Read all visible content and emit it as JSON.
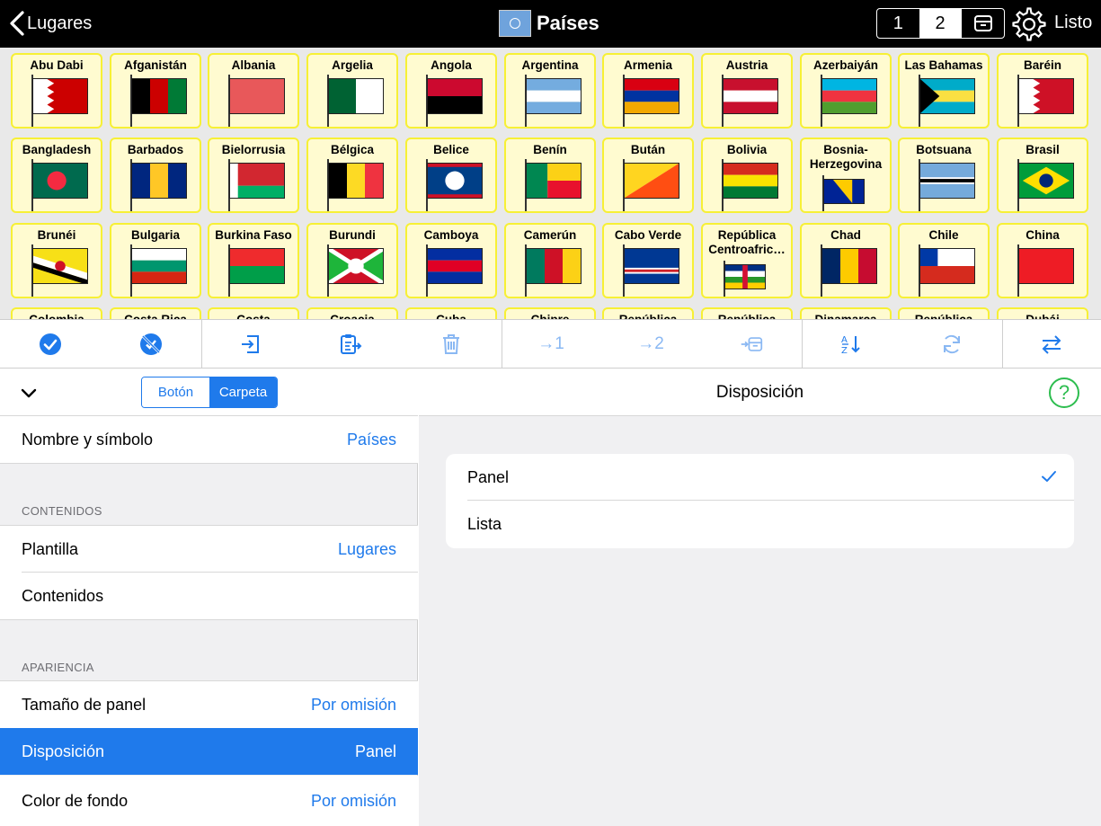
{
  "topbar": {
    "back_label": "Lugares",
    "title": "Países",
    "page_1": "1",
    "page_2": "2",
    "done_label": "Listo"
  },
  "grid": {
    "rows": [
      [
        {
          "name": "Abu Dabi",
          "colors": [
            "#c00",
            "#fff"
          ],
          "pattern": "bahrain"
        },
        {
          "name": "Afganistán",
          "colors": [
            "#000",
            "#c00",
            "#007a36"
          ],
          "pattern": "v3"
        },
        {
          "name": "Albania",
          "colors": [
            "#e8585a"
          ],
          "pattern": "solid"
        },
        {
          "name": "Argelia",
          "colors": [
            "#006233",
            "#fff"
          ],
          "pattern": "v2"
        },
        {
          "name": "Angola",
          "colors": [
            "#cc092f",
            "#000"
          ],
          "pattern": "h2"
        },
        {
          "name": "Argentina",
          "colors": [
            "#74acdf",
            "#fff",
            "#74acdf"
          ],
          "pattern": "h3"
        },
        {
          "name": "Armenia",
          "colors": [
            "#d90012",
            "#0033a0",
            "#f2a800"
          ],
          "pattern": "h3"
        },
        {
          "name": "Austria",
          "colors": [
            "#c8102e",
            "#fff",
            "#c8102e"
          ],
          "pattern": "h3"
        },
        {
          "name": "Azerbaiyán",
          "colors": [
            "#00b5e2",
            "#ef3340",
            "#509e2f"
          ],
          "pattern": "h3"
        },
        {
          "name": "Las Bahamas",
          "colors": [
            "#00abc9",
            "#fae042",
            "#00abc9"
          ],
          "pattern": "h3tri"
        },
        {
          "name": "Baréin",
          "colors": [
            "#ce1126",
            "#fff"
          ],
          "pattern": "bahrain"
        }
      ],
      [
        {
          "name": "Bangladesh",
          "colors": [
            "#006a4e"
          ],
          "pattern": "disc"
        },
        {
          "name": "Barbados",
          "colors": [
            "#00267f",
            "#ffc726",
            "#00267f"
          ],
          "pattern": "v3"
        },
        {
          "name": "Bielorrusia",
          "colors": [
            "#d22730",
            "#00af66"
          ],
          "pattern": "h2by"
        },
        {
          "name": "Bélgica",
          "colors": [
            "#000",
            "#fdda24",
            "#ef3340"
          ],
          "pattern": "v3"
        },
        {
          "name": "Belice",
          "colors": [
            "#003f87",
            "#ce1126"
          ],
          "pattern": "belize"
        },
        {
          "name": "Benín",
          "colors": [
            "#008751",
            "#fcd116",
            "#e8112d"
          ],
          "pattern": "benin"
        },
        {
          "name": "Bután",
          "colors": [
            "#ffd520",
            "#ff4e12"
          ],
          "pattern": "diag"
        },
        {
          "name": "Bolivia",
          "colors": [
            "#d52b1e",
            "#f9e300",
            "#007934"
          ],
          "pattern": "h3"
        },
        {
          "name": "Bosnia-Herzegovina",
          "colors": [
            "#002395",
            "#fecb00"
          ],
          "pattern": "bosnia",
          "two": true
        },
        {
          "name": "Botsuana",
          "colors": [
            "#75aadb",
            "#000",
            "#75aadb"
          ],
          "pattern": "h3thin"
        },
        {
          "name": "Brasil",
          "colors": [
            "#009c3b",
            "#ffdf00"
          ],
          "pattern": "brazil"
        }
      ],
      [
        {
          "name": "Brunéi",
          "colors": [
            "#f7e017",
            "#fff",
            "#000"
          ],
          "pattern": "diag2"
        },
        {
          "name": "Bulgaria",
          "colors": [
            "#fff",
            "#00966e",
            "#d62612"
          ],
          "pattern": "h3"
        },
        {
          "name": "Burkina Faso",
          "colors": [
            "#ef2b2d",
            "#009e49"
          ],
          "pattern": "h2"
        },
        {
          "name": "Burundi",
          "colors": [
            "#ce1126",
            "#1eb53a"
          ],
          "pattern": "burundi"
        },
        {
          "name": "Camboya",
          "colors": [
            "#032ea1",
            "#e00025",
            "#032ea1"
          ],
          "pattern": "h3"
        },
        {
          "name": "Camerún",
          "colors": [
            "#007a5e",
            "#ce1126",
            "#fcd116"
          ],
          "pattern": "v3"
        },
        {
          "name": "Cabo Verde",
          "colors": [
            "#003893",
            "#fff",
            "#cf2027"
          ],
          "pattern": "cv"
        },
        {
          "name": "República Centroafric…",
          "colors": [
            "#003082",
            "#fff",
            "#289728",
            "#ffce00"
          ],
          "pattern": "h4",
          "two": true
        },
        {
          "name": "Chad",
          "colors": [
            "#002664",
            "#fecb00",
            "#c60c30"
          ],
          "pattern": "v3"
        },
        {
          "name": "Chile",
          "colors": [
            "#fff",
            "#d52b1e"
          ],
          "pattern": "chile"
        },
        {
          "name": "China",
          "colors": [
            "#ee1c25"
          ],
          "pattern": "solid"
        }
      ],
      [
        {
          "name": "Colombia"
        },
        {
          "name": "Costa Rica"
        },
        {
          "name": "Costa"
        },
        {
          "name": "Croacia"
        },
        {
          "name": "Cuba"
        },
        {
          "name": "Chipre"
        },
        {
          "name": "República"
        },
        {
          "name": "República"
        },
        {
          "name": "Dinamarca"
        },
        {
          "name": "República"
        },
        {
          "name": "Dubái"
        }
      ]
    ]
  },
  "toolbar": {
    "move_1": "→1",
    "move_2": "→2",
    "buttons": [
      "select-all",
      "deselect",
      "import",
      "paste",
      "delete",
      "move-page-1",
      "move-page-2",
      "move-to-box",
      "sort",
      "refresh",
      "swap"
    ]
  },
  "left": {
    "seg_button": "Botón",
    "seg_folder": "Carpeta",
    "name_symbol": {
      "label": "Nombre y símbolo",
      "value": "Países"
    },
    "section_contents": "CONTENIDOS",
    "template": {
      "label": "Plantilla",
      "value": "Lugares"
    },
    "contents": {
      "label": "Contenidos"
    },
    "section_appearance": "APARIENCIA",
    "panel_size": {
      "label": "Tamaño de panel",
      "value": "Por omisión"
    },
    "layout": {
      "label": "Disposición",
      "value": "Panel"
    },
    "background": {
      "label": "Color de fondo",
      "value": "Por omisión"
    }
  },
  "right": {
    "title": "Disposición",
    "help": "?",
    "options": [
      {
        "label": "Panel",
        "selected": true
      },
      {
        "label": "Lista",
        "selected": false
      }
    ]
  },
  "colors": {
    "accent": "#1f7aeb",
    "cell_bg": "#fffbd0",
    "cell_border": "#f7f035",
    "help_green": "#2dbd4f"
  }
}
